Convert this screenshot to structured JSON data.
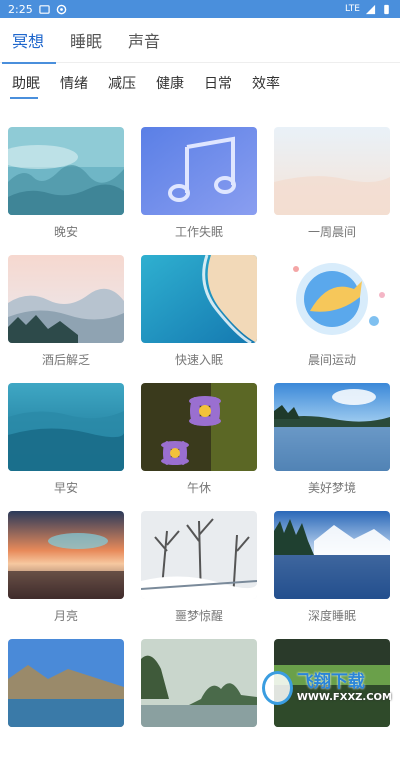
{
  "status": {
    "time": "2:25",
    "network": "LTE"
  },
  "tabs": [
    {
      "label": "冥想"
    },
    {
      "label": "睡眠"
    },
    {
      "label": "声音"
    }
  ],
  "categories": [
    {
      "label": "助眠"
    },
    {
      "label": "情绪"
    },
    {
      "label": "减压"
    },
    {
      "label": "健康"
    },
    {
      "label": "日常"
    },
    {
      "label": "效率"
    }
  ],
  "cards": [
    {
      "label": "晚安"
    },
    {
      "label": "工作失眠"
    },
    {
      "label": "一周晨间"
    },
    {
      "label": "酒后解乏"
    },
    {
      "label": "快速入眠"
    },
    {
      "label": "晨间运动"
    },
    {
      "label": "早安"
    },
    {
      "label": "午休"
    },
    {
      "label": "美好梦境"
    },
    {
      "label": "月亮"
    },
    {
      "label": "噩梦惊醒"
    },
    {
      "label": "深度睡眠"
    },
    {
      "label": ""
    },
    {
      "label": ""
    },
    {
      "label": ""
    }
  ],
  "watermark": {
    "title": "飞翔下载",
    "url": "WWW.FXXZ.COM"
  }
}
